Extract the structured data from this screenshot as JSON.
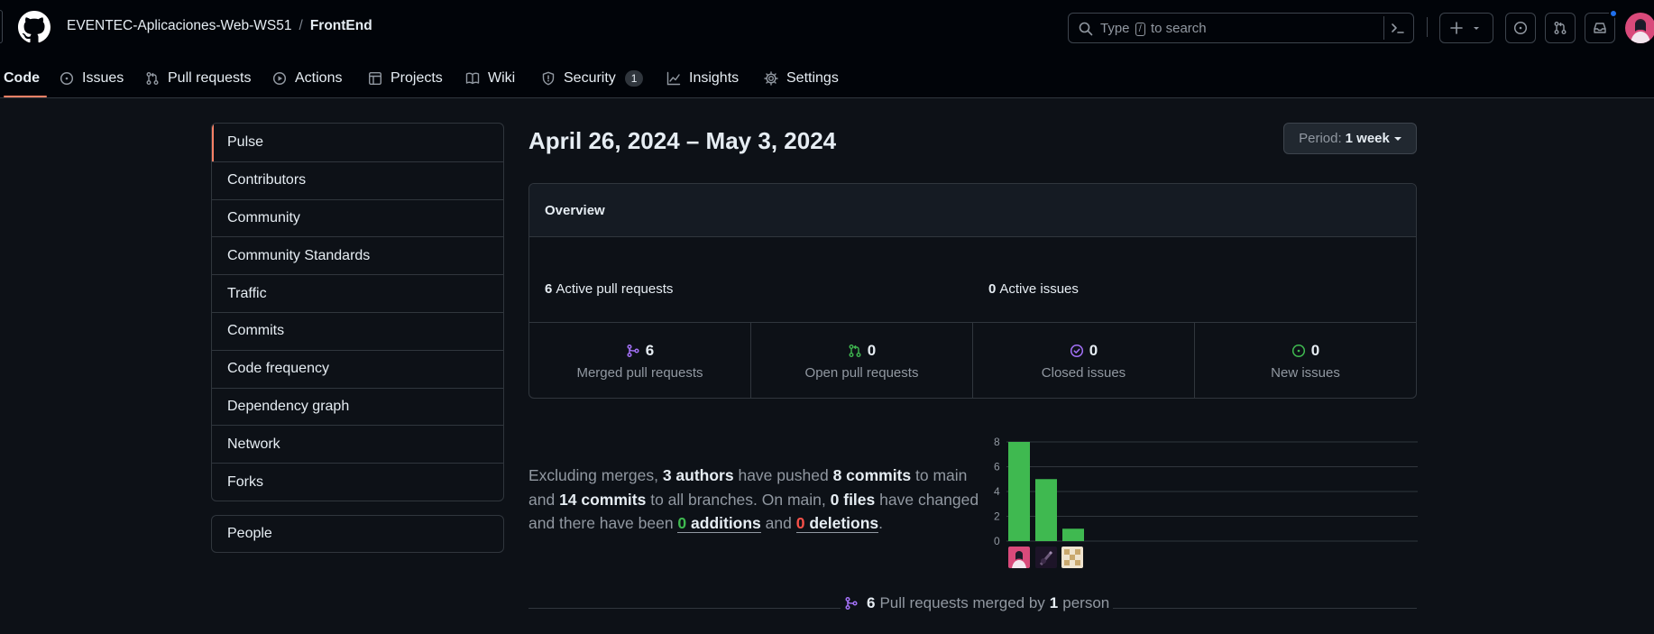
{
  "header": {
    "owner": "EVENTEC-Aplicaciones-Web-WS51",
    "separator": "/",
    "repo": "FrontEnd",
    "search": {
      "prefix": "Type",
      "key": "/",
      "suffix": "to search"
    }
  },
  "repo_nav": [
    {
      "label": "Code",
      "icon": "code-icon"
    },
    {
      "label": "Issues",
      "icon": "issue-opened-icon"
    },
    {
      "label": "Pull requests",
      "icon": "git-pull-request-icon"
    },
    {
      "label": "Actions",
      "icon": "play-icon"
    },
    {
      "label": "Projects",
      "icon": "table-icon"
    },
    {
      "label": "Wiki",
      "icon": "book-icon"
    },
    {
      "label": "Security",
      "icon": "shield-icon",
      "counter": "1"
    },
    {
      "label": "Insights",
      "icon": "graph-icon"
    },
    {
      "label": "Settings",
      "icon": "gear-icon"
    }
  ],
  "sidebar": {
    "items": [
      "Pulse",
      "Contributors",
      "Community",
      "Community Standards",
      "Traffic",
      "Commits",
      "Code frequency",
      "Dependency graph",
      "Network",
      "Forks"
    ],
    "selected": "Pulse",
    "people": "People"
  },
  "main": {
    "date_range": "April 26, 2024 – May 3, 2024",
    "period": {
      "label": "Period:",
      "value": "1 week"
    }
  },
  "overview": {
    "title": "Overview",
    "active_prs": {
      "count": "6",
      "label": "Active pull requests",
      "fill": 1.0
    },
    "active_issues": {
      "count": "0",
      "label": "Active issues",
      "fill": 0.0
    },
    "stats": [
      {
        "value": "6",
        "label": "Merged pull requests",
        "icon": "git-merge-icon",
        "color": "#a371f7"
      },
      {
        "value": "0",
        "label": "Open pull requests",
        "icon": "git-pull-request-icon",
        "color": "#3fb950"
      },
      {
        "value": "0",
        "label": "Closed issues",
        "icon": "issue-closed-icon",
        "color": "#a371f7"
      },
      {
        "value": "0",
        "label": "New issues",
        "icon": "issue-opened-icon",
        "color": "#3fb950"
      }
    ]
  },
  "summary": {
    "t1": "Excluding merges, ",
    "authors": "3 authors",
    "t2": " have pushed ",
    "commits_main": "8 commits",
    "t3": " to main and ",
    "commits_all": "14 commits",
    "t4": " to all branches. On main, ",
    "files": "0 files",
    "t5": " have changed and there have been ",
    "additions_n": "0",
    "additions_l": " additions",
    "t6": " and ",
    "deletions_n": "0",
    "deletions_l": " deletions",
    "t7": "."
  },
  "chart_data": {
    "type": "bar",
    "categories": [
      "author 1",
      "author 2",
      "author 3"
    ],
    "values": [
      8,
      5,
      1
    ],
    "ylim": [
      0,
      8
    ],
    "yticks": [
      0,
      2,
      4,
      6,
      8
    ],
    "bar_color": "#3fb950",
    "grid": true
  },
  "bottom": {
    "count": "6",
    "text1": "Pull requests merged by",
    "persons": "1",
    "text2": "person"
  },
  "colors": {
    "background": "#0d1117",
    "header_bg": "#010409",
    "border": "#30363d",
    "accent_underline": "#f78166",
    "purple": "#8957e5",
    "green": "#3fb950",
    "red": "#f85149",
    "notification": "#1f6feb"
  }
}
